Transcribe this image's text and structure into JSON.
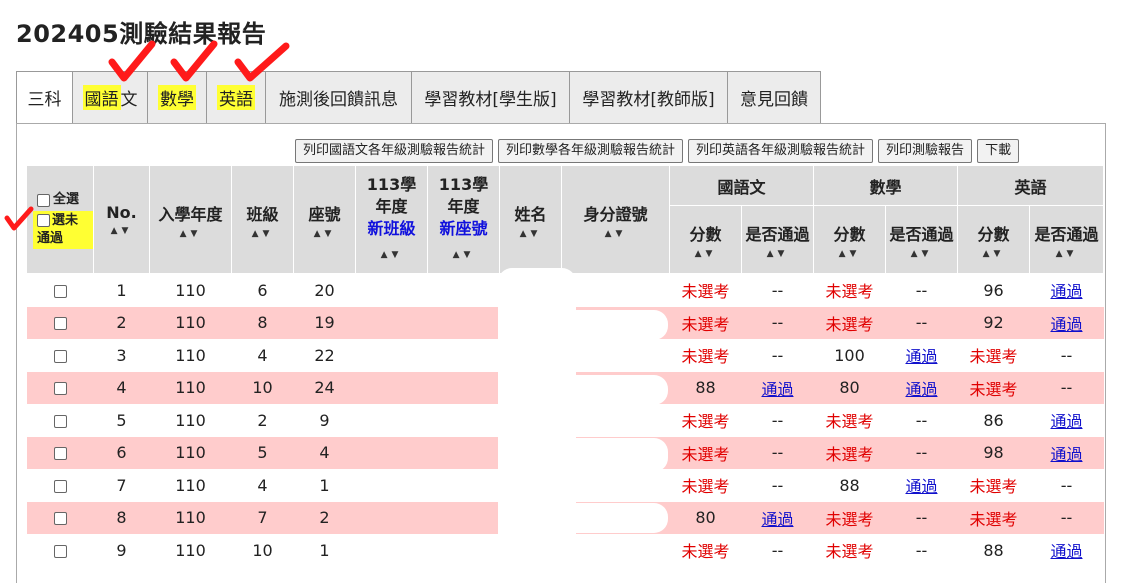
{
  "page_title": "202405測驗結果報告",
  "tabs": [
    {
      "label": "三科",
      "highlight": false
    },
    {
      "label": "國語",
      "label_rest": "文",
      "highlight": true
    },
    {
      "label": "數學",
      "highlight": true
    },
    {
      "label": "英語",
      "highlight": true
    },
    {
      "label": "施測後回饋訊息",
      "highlight": false
    },
    {
      "label": "學習教材[學生版]",
      "highlight": false
    },
    {
      "label": "學習教材[教師版]",
      "highlight": false
    },
    {
      "label": "意見回饋",
      "highlight": false
    }
  ],
  "buttons": {
    "print_chinese": "列印國語文各年級測驗報告統計",
    "print_math": "列印數學各年級測驗報告統計",
    "print_english": "列印英語各年級測驗報告統計",
    "print_report": "列印測驗報告",
    "download": "下載"
  },
  "header": {
    "select_all": "全選",
    "select_unpassed": "選未通過",
    "no": "No.",
    "enroll_year": "入學年度",
    "class": "班級",
    "seat": "座號",
    "y113_a": "113學年度",
    "new_class": "新班級",
    "y113_b": "113學年度",
    "new_seat": "新座號",
    "name": "姓名",
    "id_number": "身分證號",
    "chinese": "國語文",
    "math": "數學",
    "english": "英語",
    "score": "分數",
    "passed": "是否通過",
    "sort_arrows": "▲▼"
  },
  "rows": [
    {
      "no": "1",
      "year": "110",
      "class": "6",
      "seat": "20",
      "c_score": "未選考",
      "c_pass": "--",
      "m_score": "未選考",
      "m_pass": "--",
      "e_score": "96",
      "e_pass": "通過"
    },
    {
      "no": "2",
      "year": "110",
      "class": "8",
      "seat": "19",
      "c_score": "未選考",
      "c_pass": "--",
      "m_score": "未選考",
      "m_pass": "--",
      "e_score": "92",
      "e_pass": "通過"
    },
    {
      "no": "3",
      "year": "110",
      "class": "4",
      "seat": "22",
      "c_score": "未選考",
      "c_pass": "--",
      "m_score": "100",
      "m_pass": "通過",
      "e_score": "未選考",
      "e_pass": "--"
    },
    {
      "no": "4",
      "year": "110",
      "class": "10",
      "seat": "24",
      "c_score": "88",
      "c_pass": "通過",
      "m_score": "80",
      "m_pass": "通過",
      "e_score": "未選考",
      "e_pass": "--"
    },
    {
      "no": "5",
      "year": "110",
      "class": "2",
      "seat": "9",
      "c_score": "未選考",
      "c_pass": "--",
      "m_score": "未選考",
      "m_pass": "--",
      "e_score": "86",
      "e_pass": "通過"
    },
    {
      "no": "6",
      "year": "110",
      "class": "5",
      "seat": "4",
      "c_score": "未選考",
      "c_pass": "--",
      "m_score": "未選考",
      "m_pass": "--",
      "e_score": "98",
      "e_pass": "通過"
    },
    {
      "no": "7",
      "year": "110",
      "class": "4",
      "seat": "1",
      "c_score": "未選考",
      "c_pass": "--",
      "m_score": "88",
      "m_pass": "通過",
      "e_score": "未選考",
      "e_pass": "--"
    },
    {
      "no": "8",
      "year": "110",
      "class": "7",
      "seat": "2",
      "c_score": "80",
      "c_pass": "通過",
      "m_score": "未選考",
      "m_pass": "--",
      "e_score": "未選考",
      "e_pass": "--"
    },
    {
      "no": "9",
      "year": "110",
      "class": "10",
      "seat": "1",
      "c_score": "未選考",
      "c_pass": "--",
      "m_score": "未選考",
      "m_pass": "--",
      "e_score": "88",
      "e_pass": "通過"
    }
  ],
  "colors": {
    "pink_row": "#ffcccc",
    "not_taken": "#e00000",
    "passed_link": "#1010cc",
    "highlight": "#ffff33",
    "checkmark": "#ff1a1a"
  }
}
